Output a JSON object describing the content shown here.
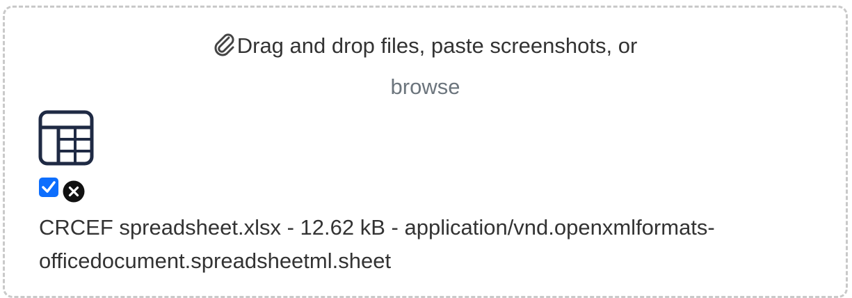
{
  "dropzone": {
    "prompt": "Drag and drop files, paste screenshots, or",
    "browse_label": "browse",
    "prompt_icon": "paperclip-icon"
  },
  "file": {
    "icon": "spreadsheet-icon",
    "name": "CRCEF spreadsheet.xlsx",
    "size": "12.62 kB",
    "mime": "application/vnd.openxmlformats-officedocument.spreadsheetml.sheet",
    "info_line": "CRCEF spreadsheet.xlsx - 12.62 kB - application/vnd.openxmlformats-officedocument.spreadsheetml.sheet",
    "selected": true,
    "remove_icon": "close-circle-icon"
  },
  "colors": {
    "checkbox": "#0d6efd",
    "icon_dark": "#1f2a44",
    "border": "#c9c9c9",
    "browse_text": "#6c757d"
  }
}
